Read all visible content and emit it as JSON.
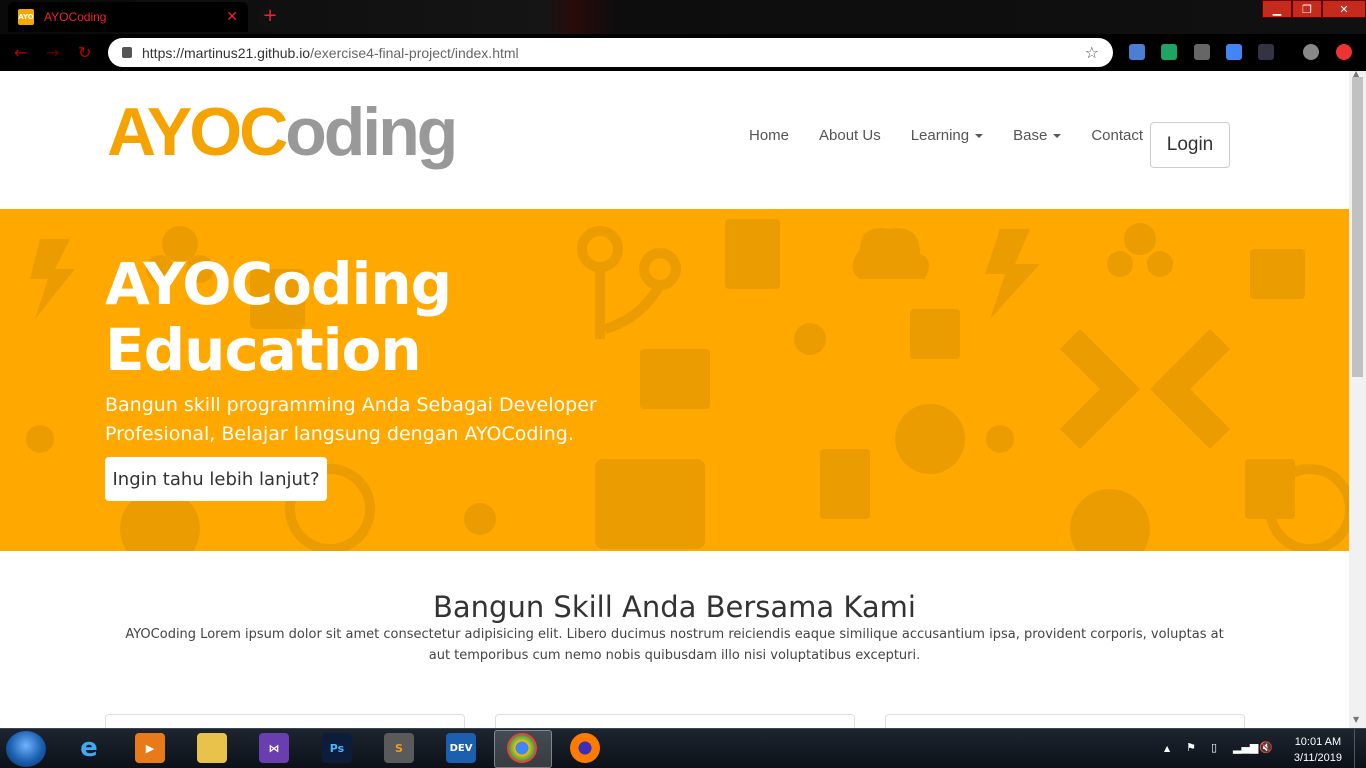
{
  "browser": {
    "tab_title": "AYOCoding",
    "tab_favicon_text": "AYO",
    "url_host": "https://martinus21.github.io",
    "url_path": "/exercise4-final-project/index.html"
  },
  "site": {
    "logo_primary": "AYOC",
    "logo_secondary": "oding",
    "nav": {
      "home": "Home",
      "about": "About Us",
      "learning": "Learning",
      "base": "Base",
      "contact": "Contact",
      "login": "Login"
    },
    "hero": {
      "title_line1": "AYOCoding",
      "title_line2": "Education",
      "subtitle": "Bangun skill programming Anda Sebagai Developer Profesional, Belajar langsung dengan AYOCoding.",
      "button": "Ingin tahu lebih lanjut?",
      "background_color": "#ffa800"
    },
    "section": {
      "title": "Bangun Skill Anda Bersama Kami",
      "text": "AYOCoding Lorem ipsum dolor sit amet consectetur adipisicing elit. Libero ducimus nostrum reiciendis eaque similique accusantium ipsa, provident corporis, voluptas at aut temporibus cum nemo nobis quibusdam illo nisi voluptatibus excepturi."
    }
  },
  "taskbar": {
    "apps": [
      "internet-explorer",
      "media-player",
      "file-explorer",
      "visual-studio",
      "photoshop",
      "sublime-text",
      "devexpress",
      "chrome",
      "firefox"
    ],
    "ps_label": "Ps",
    "dev_label": "DEV",
    "time": "10:01 AM",
    "date": "3/11/2019"
  },
  "colors": {
    "accent": "#f5a300",
    "logo_gray": "#999999",
    "browser_accent": "#ee2233"
  }
}
